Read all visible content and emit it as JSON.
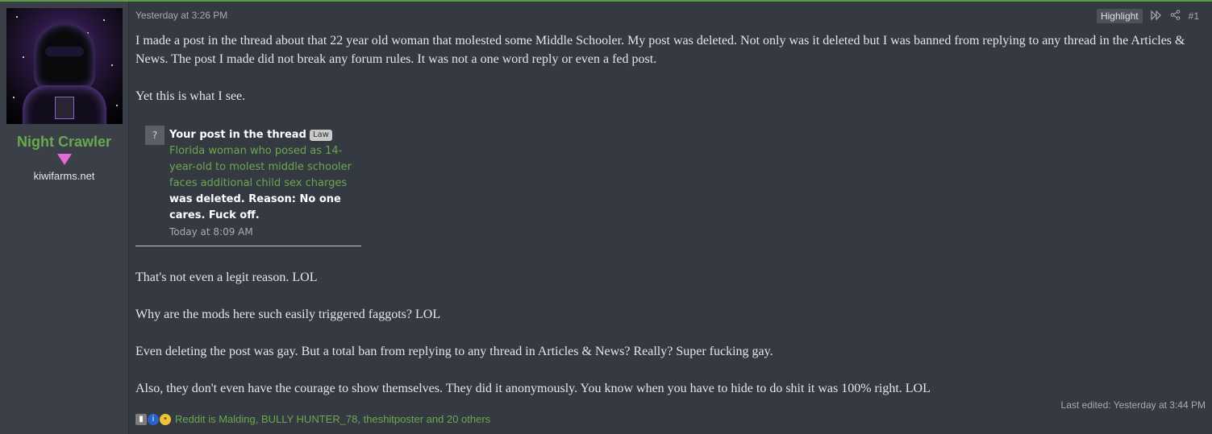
{
  "user": {
    "name": "Night Crawler",
    "title": "kiwifarms.net"
  },
  "post": {
    "date": "Yesterday at 3:26 PM",
    "highlight_label": "Highlight",
    "number": "#1",
    "paragraphs_top": [
      "I made a post in the thread about that 22 year old woman that molested some Middle Schooler. My post was deleted. Not only was it deleted but I was banned from replying to any thread in the Articles & News. The post I made did not break any forum rules. It was not a one word reply or even a fed post.",
      "Yet this is what I see."
    ],
    "alert": {
      "icon": "?",
      "prefix_text": "Your post in the thread",
      "prefix_tag": "Law",
      "thread_link": "Florida woman who posed as 14-year-old to molest middle schooler faces additional child sex charges",
      "suffix_text": "was deleted. Reason: No one cares. Fuck off.",
      "time": "Today at 8:09 AM"
    },
    "paragraphs_bottom": [
      "That's not even a legit reason. LOL",
      "Why are the mods here such easily triggered faggots? LOL",
      "Even deleting the post was gay. But a total ban from replying to any thread in Articles & News? Really? Super fucking gay.",
      "Also, they don't even have the courage to show themselves. They did it anonymously. You know when you have to hide to do shit it was 100% right. LOL"
    ],
    "last_edited": "Last edited: Yesterday at 3:44 PM",
    "reactions_text": "Reddit is Malding, BULLY HUNTER_78, theshitposter and 20 others"
  },
  "icons": {
    "forward": "fast-forward-icon",
    "share": "share-icon",
    "reaction_1": "thumb-icon",
    "reaction_2": "info-icon",
    "reaction_3": "thinking-face-icon"
  },
  "colors": {
    "accent_green": "#6aa84f",
    "top_border": "#5d9b48",
    "user_marker": "#e36bd6"
  }
}
